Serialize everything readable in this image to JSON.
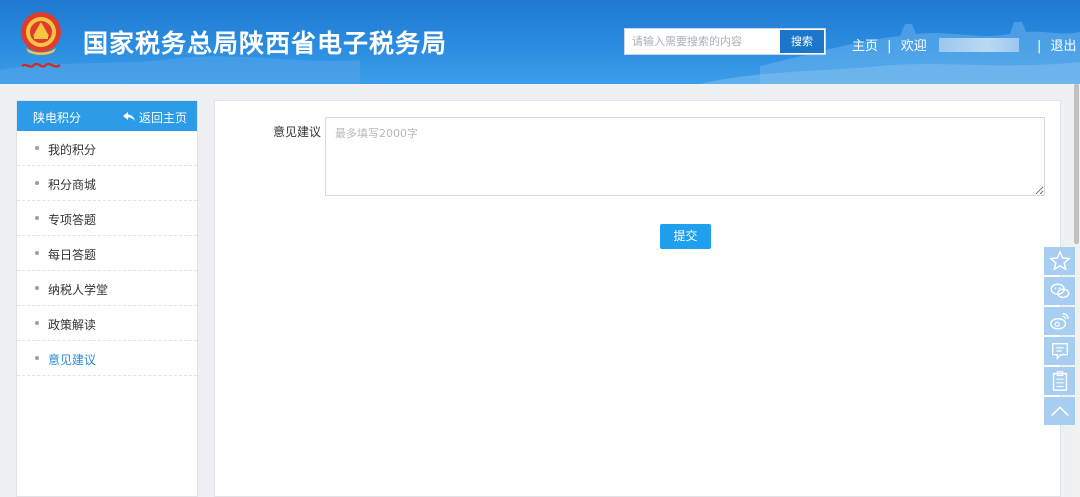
{
  "header": {
    "title": "国家税务总局陕西省电子税务局",
    "search": {
      "placeholder": "请输入需要搜索的内容",
      "value": "",
      "button_label": "搜索"
    },
    "nav": {
      "home": "主页",
      "separator": "|",
      "welcome": "欢迎",
      "logout": "退出"
    }
  },
  "sidebar": {
    "title": "陕电积分",
    "back_label": "返回主页",
    "items": [
      {
        "label": "我的积分",
        "active": false
      },
      {
        "label": "积分商城",
        "active": false
      },
      {
        "label": "专项答题",
        "active": false
      },
      {
        "label": "每日答题",
        "active": false
      },
      {
        "label": "纳税人学堂",
        "active": false
      },
      {
        "label": "政策解读",
        "active": false
      },
      {
        "label": "意见建议",
        "active": true
      }
    ]
  },
  "main": {
    "field_label": "意见建议",
    "textarea": {
      "placeholder": "最多填写2000字",
      "value": ""
    },
    "submit_label": "提交"
  },
  "float_toolbar": {
    "icons": [
      "star-icon",
      "wechat-icon",
      "weibo-icon",
      "message-icon",
      "clipboard-icon",
      "back-to-top-icon"
    ]
  },
  "colors": {
    "header_blue": "#2a8ce0",
    "sidebar_header": "#2c9ce8",
    "active_item": "#2a8ad6",
    "submit_button": "#1ea0ef",
    "float_button": "#a7cdf0"
  }
}
